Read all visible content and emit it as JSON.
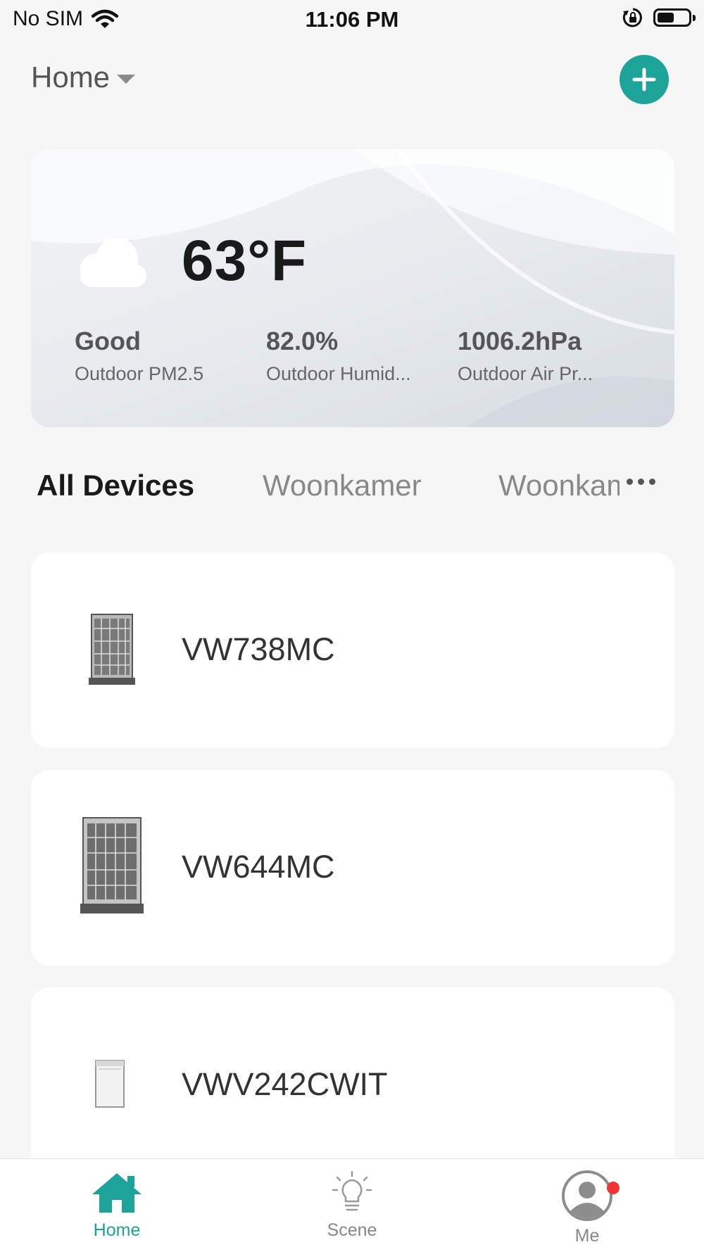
{
  "status_bar": {
    "carrier": "No SIM",
    "time": "11:06 PM",
    "battery_level": 0.55
  },
  "header": {
    "home_label": "Home"
  },
  "weather": {
    "temperature": "63°F",
    "metrics": [
      {
        "value": "Good",
        "label": "Outdoor PM2.5"
      },
      {
        "value": "82.0%",
        "label": "Outdoor Humid..."
      },
      {
        "value": "1006.2hPa",
        "label": "Outdoor Air Pr..."
      }
    ]
  },
  "room_tabs": [
    "All Devices",
    "Woonkamer",
    "Woonkamer"
  ],
  "devices": [
    {
      "name": "VW738MC",
      "icon": "built-in-dishwasher-open"
    },
    {
      "name": "VW644MC",
      "icon": "built-in-dishwasher-open"
    },
    {
      "name": "VWV242CWIT",
      "icon": "freestanding-dishwasher-white"
    }
  ],
  "tabbar": {
    "items": [
      {
        "label": "Home",
        "icon": "home-icon"
      },
      {
        "label": "Scene",
        "icon": "lightbulb-icon"
      },
      {
        "label": "Me",
        "icon": "user-icon"
      }
    ],
    "active_color": "#1ea39b"
  },
  "colors": {
    "accent": "#1ea39b",
    "notification": "#ee3434"
  }
}
